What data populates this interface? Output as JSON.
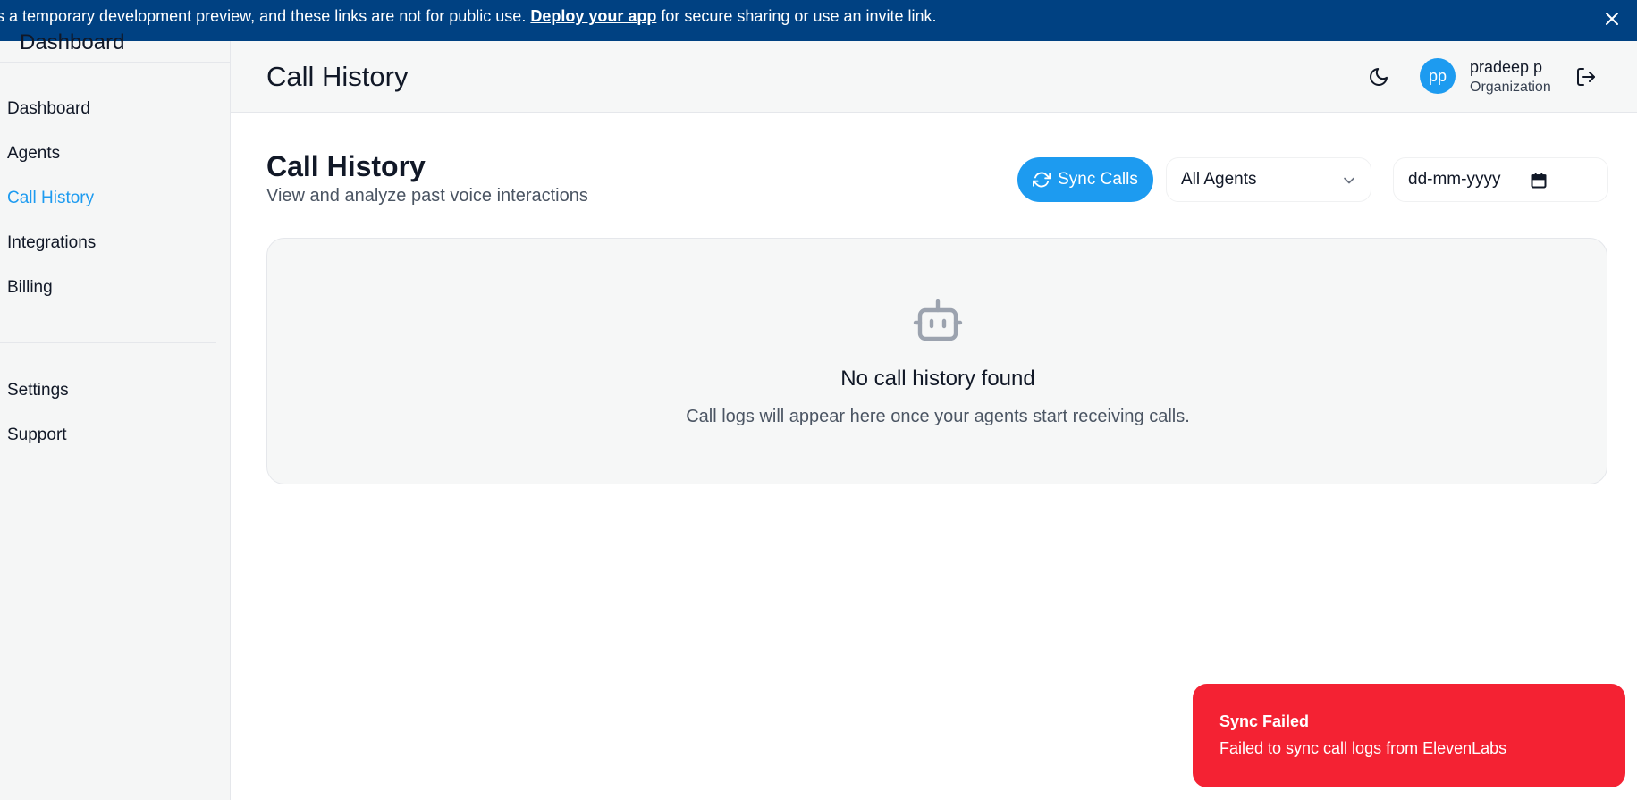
{
  "banner": {
    "text_before": "s a temporary development preview, and these links are not for public use. ",
    "link_label": "Deploy your app",
    "text_after": " for secure sharing or use an invite link.",
    "color": "#004182"
  },
  "sidebar": {
    "brand": "Dashboard",
    "items": [
      {
        "label": "Dashboard",
        "active": false
      },
      {
        "label": "Agents",
        "active": false
      },
      {
        "label": "Call History",
        "active": true
      },
      {
        "label": "Integrations",
        "active": false
      },
      {
        "label": "Billing",
        "active": false
      }
    ],
    "secondary_items": [
      {
        "label": "Settings"
      },
      {
        "label": "Support"
      }
    ],
    "active_color": "#1d9bf0"
  },
  "header": {
    "title": "Call History",
    "theme_icon": "moon-icon",
    "user": {
      "initials": "pp",
      "name": "pradeep p",
      "role": "Organization"
    },
    "logout_icon": "logout-icon"
  },
  "main": {
    "title": "Call History",
    "subtitle": "View and analyze past voice interactions",
    "sync_button": "Sync Calls",
    "agent_filter": {
      "selected": "All Agents"
    },
    "date_filter": {
      "placeholder": "dd-mm-yyyy"
    },
    "empty_state": {
      "icon": "bot-icon",
      "title": "No call history found",
      "description": "Call logs will appear here once your agents start receiving calls."
    }
  },
  "toast": {
    "title": "Sync Failed",
    "message": "Failed to sync call logs from ElevenLabs",
    "color": "#f42233"
  }
}
